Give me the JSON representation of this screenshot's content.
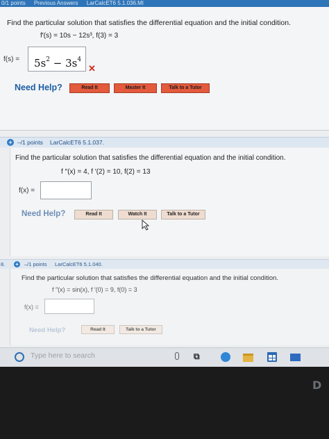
{
  "problem1": {
    "header": {
      "points": "0/1 points",
      "previous": "Previous Answers",
      "ref": "LarCalcET6 5.1.036.MI"
    },
    "question": "Find the particular solution that satisfies the differential equation and the initial condition.",
    "equation": "f′(s) = 10s − 12s³,   f(3) = 3",
    "answer_label": "f(s) =",
    "answer_value": "5s² − 3s⁴",
    "result": "✕",
    "help_label": "Need Help?",
    "buttons": [
      "Read It",
      "Master It",
      "Talk to a Tutor"
    ]
  },
  "problem2": {
    "header": {
      "points": "–/1 points",
      "ref": "LarCalcET6 5.1.037."
    },
    "question": "Find the particular solution that satisfies the differential equation and the initial condition.",
    "equation": "f ″(x) = 4,    f ′(2) = 10,    f(2) = 13",
    "answer_label": "f(x) =",
    "answer_value": "",
    "help_label": "Need Help?",
    "buttons": [
      "Read It",
      "Watch It",
      "Talk to a Tutor"
    ]
  },
  "problem3": {
    "header": {
      "number": "8.",
      "points": "–/1 points",
      "ref": "LarCalcET6 5.1.040."
    },
    "question": "Find the particular solution that satisfies the differential equation and the initial condition.",
    "equation": "f ″(x) = sin(x),    f ′(0) = 9,    f(0) = 3",
    "answer_label": "f(x) =",
    "answer_value": "",
    "help_label": "Need Help?",
    "buttons": [
      "Read It",
      "Talk to a Tutor"
    ]
  },
  "taskbar": {
    "search_placeholder": "Type here to search"
  },
  "bezel": {
    "logo": "D"
  },
  "colors": {
    "accent": "#2e74b8",
    "button_red": "#e35a3c",
    "wrong_mark": "#d32a20"
  }
}
